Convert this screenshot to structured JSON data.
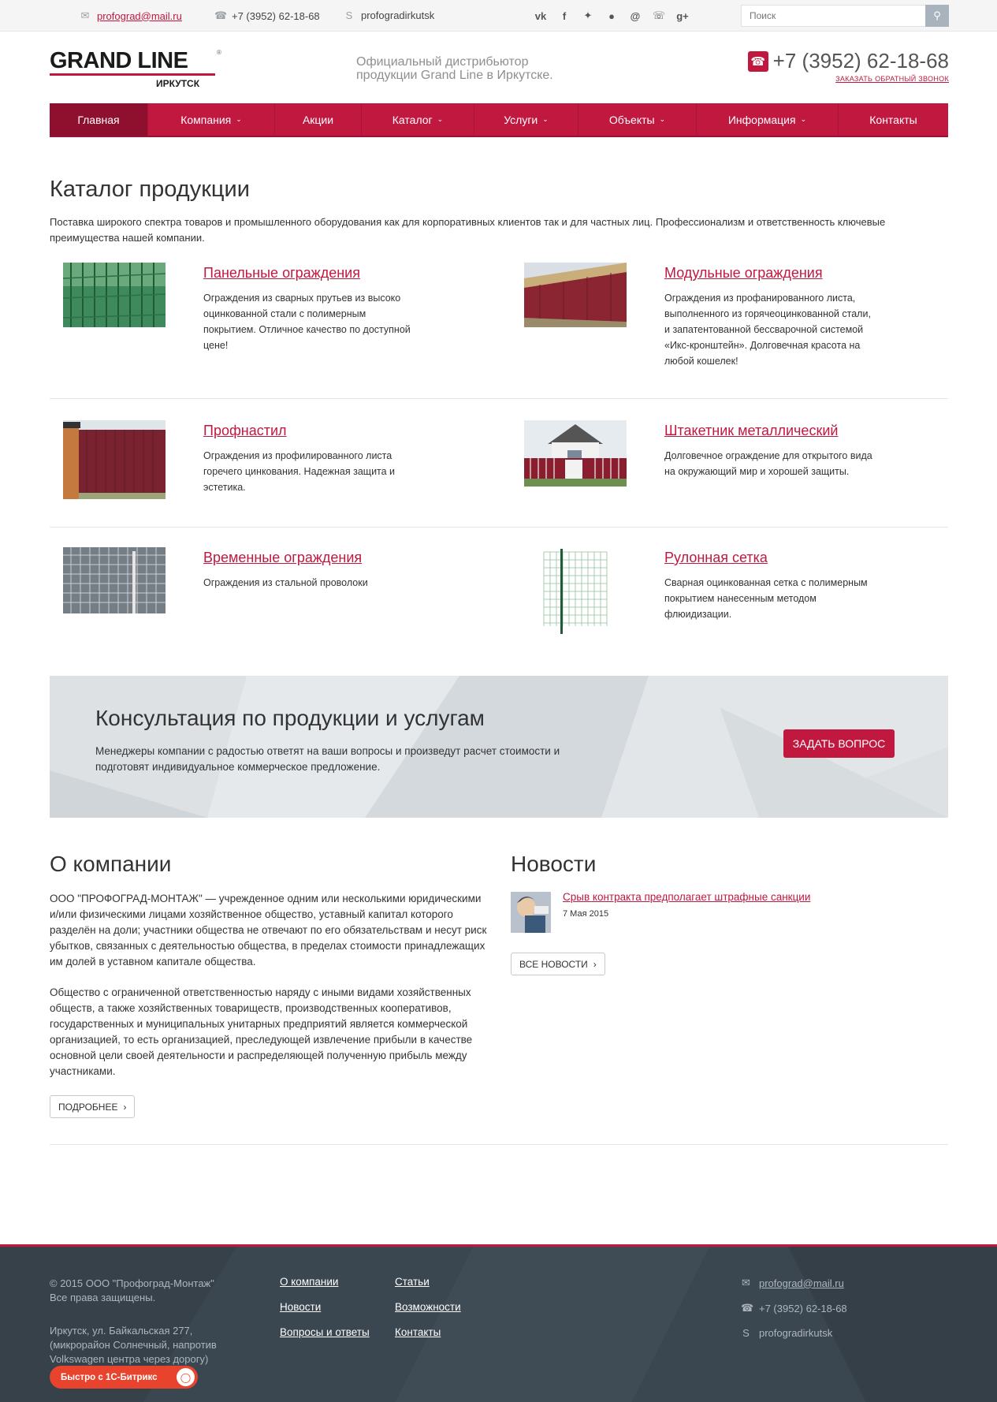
{
  "topbar": {
    "email": "profograd@mail.ru",
    "phone": "+7 (3952) 62-18-68",
    "skype": "profogradirkutsk",
    "social": [
      "vk",
      "f",
      "t",
      "ok",
      "@",
      "viber",
      "g+"
    ],
    "search_placeholder": "Поиск"
  },
  "header": {
    "logo_text": "GRAND LINE",
    "logo_city": "ИРКУТСК",
    "tagline_line1": "Официальный дистрибьютор",
    "tagline_line2": "продукции Grand Line в Иркутске.",
    "phone": "+7 (3952) 62-18-68",
    "callback": "ЗАКАЗАТЬ ОБРАТНЫЙ ЗВОНОК"
  },
  "nav": [
    {
      "label": "Главная",
      "dropdown": false
    },
    {
      "label": "Компания",
      "dropdown": true
    },
    {
      "label": "Акции",
      "dropdown": false
    },
    {
      "label": "Каталог",
      "dropdown": true
    },
    {
      "label": "Услуги",
      "dropdown": true
    },
    {
      "label": "Объекты",
      "dropdown": true
    },
    {
      "label": "Информация",
      "dropdown": true
    },
    {
      "label": "Контакты",
      "dropdown": false
    }
  ],
  "catalog": {
    "title": "Каталог продукции",
    "intro": "Поставка широкого спектра товаров и промышленного оборудования как для корпоративных клиентов так и для частных лиц. Профессионализм и ответственность ключевые преимущества нашей компании.",
    "products": [
      {
        "name": "Панельные ограждения",
        "desc": "Ограждения из сварных прутьев из высоко оцинкованной стали с полимерным покрытием. Отличное качество по доступной цене!"
      },
      {
        "name": "Модульные ограждения",
        "desc": "Ограждения из профанированного листа, выполненного из горячеоцинкованной стали, и запатентованной бессварочной системой «Икс-кронштейн». Долговечная красота на любой кошелек!"
      },
      {
        "name": "Профнастил",
        "desc": "Ограждения из профилированного листа горечего цинкования. Надежная защита и эстетика."
      },
      {
        "name": "Штакетник металлический",
        "desc": "Долговечное ограждение для открытого вида на окружающий мир и хорошей защиты."
      },
      {
        "name": "Временные ограждения",
        "desc": "Ограждения из стальной проволоки"
      },
      {
        "name": "Рулонная сетка",
        "desc": "Сварная оцинкованная сетка с полимерным покрытием нанесенным методом флюидизации."
      }
    ]
  },
  "consult": {
    "title": "Консультация по продукции и услугам",
    "text": "Менеджеры компании с радостью ответят на ваши вопросы и произведут расчет стоимости и подготовят индивидуальное коммерческое предложение.",
    "button": "ЗАДАТЬ ВОПРОС"
  },
  "about": {
    "title": "О компании",
    "p1": "ООО \"ПРОФОГРАД-МОНТАЖ\" — учрежденное одним или несколькими юридическими и/или физическими лицами хозяйственное общество, уставный капитал которого разделён на доли; участники общества не отвечают по его обязательствам и несут риск убытков, связанных с деятельностью общества, в пределах стоимости принадлежащих им долей в уставном капитале общества.",
    "p2": "Общество с ограниченной ответственностью наряду с иными видами хозяйственных обществ, а также хозяйственных товариществ, производственных кооперативов, государственных и муниципальных унитарных предприятий является коммерческой организацией, то есть организацией, преследующей извлечение прибыли в качестве основной цели своей деятельности и распределяющей полученную прибыль между участниками.",
    "button": "ПОДРОБНЕЕ"
  },
  "news": {
    "title": "Новости",
    "item_title": "Срыв контракта предполагает штрафные санкции",
    "item_date": "7 Мая 2015",
    "button": "ВСЕ НОВОСТИ"
  },
  "footer": {
    "copy1": "© 2015 ООО \"Профоград-Монтаж\"",
    "copy2": "Все права защищены.",
    "address": "Иркутск, ул. Байкальская 277, (микрорайон Солнечный, напротив Volkswagen центра через дорогу)",
    "bitrix": "Быстро с 1С-Битрикс",
    "links_col1": [
      "О компании",
      "Новости",
      "Вопросы и ответы"
    ],
    "links_col2": [
      "Статьи",
      "Возможности",
      "Контакты"
    ],
    "email": "profograd@mail.ru",
    "phone": "+7 (3952) 62-18-68",
    "skype": "profogradirkutsk"
  },
  "colors": {
    "accent": "#c0183f",
    "footer_bg": "#3a4650",
    "consult_bg": "#dde1e4"
  }
}
